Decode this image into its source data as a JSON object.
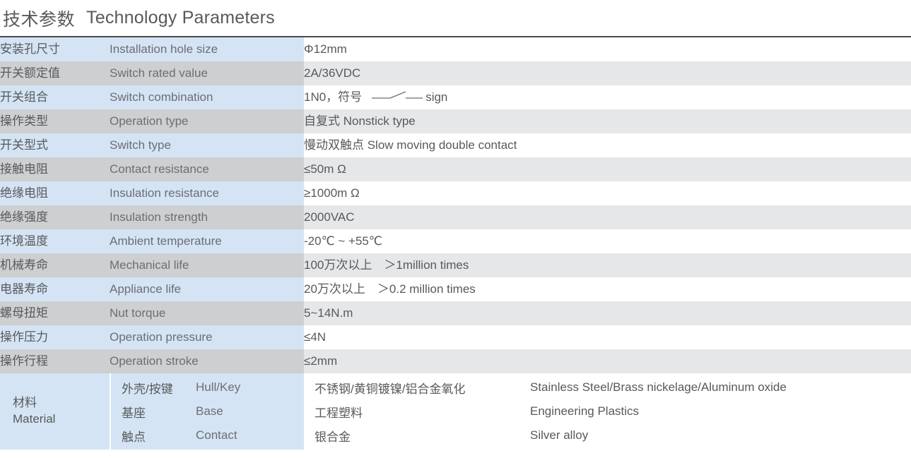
{
  "header": {
    "title_cn": "技术参数",
    "title_en": "Technology Parameters"
  },
  "table": {
    "rows": [
      {
        "cn": "安装孔尺寸",
        "en": "Installation hole size",
        "value": "Φ12mm"
      },
      {
        "cn": "开关额定值",
        "en": "Switch rated value",
        "value": "2A/36VDC"
      },
      {
        "cn": "开关组合",
        "en": "Switch combination",
        "value_pre": "1N0，符号",
        "value_post": "sign",
        "has_symbol": true
      },
      {
        "cn": "操作类型",
        "en": "Operation type",
        "value": "自复式 Nonstick type"
      },
      {
        "cn": "开关型式",
        "en": "Switch type",
        "value": "慢动双触点 Slow moving double contact"
      },
      {
        "cn": "接触电阻",
        "en": "Contact resistance",
        "value": "≤50m Ω"
      },
      {
        "cn": "绝缘电阻",
        "en": "Insulation resistance",
        "value": "≥1000m Ω"
      },
      {
        "cn": "绝缘强度",
        "en": "Insulation strength",
        "value": "2000VAC"
      },
      {
        "cn": "环境温度",
        "en": "Ambient temperature",
        "value": "-20℃ ~ +55℃"
      },
      {
        "cn": "机械寿命",
        "en": "Mechanical life",
        "value": "100万次以上　＞1million times"
      },
      {
        "cn": "电器寿命",
        "en": "Appliance life",
        "value": "20万次以上　＞0.2 million times"
      },
      {
        "cn": "螺母扭矩",
        "en": "Nut torque",
        "value": "5~14N.m"
      },
      {
        "cn": "操作压力",
        "en": "Operation pressure",
        "value": "≤4N"
      },
      {
        "cn": "操作行程",
        "en": "Operation stroke",
        "value": "≤2mm"
      }
    ]
  },
  "material": {
    "label_cn": "材料",
    "label_en": "Material",
    "items": [
      {
        "sub_cn": "外壳/按键",
        "sub_en": "Hull/Key",
        "value_cn": "不锈钢/黄铜镀镍/铝合金氧化",
        "value_en": "Stainless Steel/Brass nickelage/Aluminum oxide"
      },
      {
        "sub_cn": "基座",
        "sub_en": "Base",
        "value_cn": "工程塑料",
        "value_en": "Engineering Plastics"
      },
      {
        "sub_cn": "触点",
        "sub_en": "Contact",
        "value_cn": "银合金",
        "value_en": "Silver alloy"
      }
    ]
  },
  "colors": {
    "tint_blue": "#d4e4f4",
    "tint_gray": "#cdcfd1",
    "value_gray": "#e6e7e9",
    "text": "#58595b",
    "rule": "#4a4a4c"
  }
}
